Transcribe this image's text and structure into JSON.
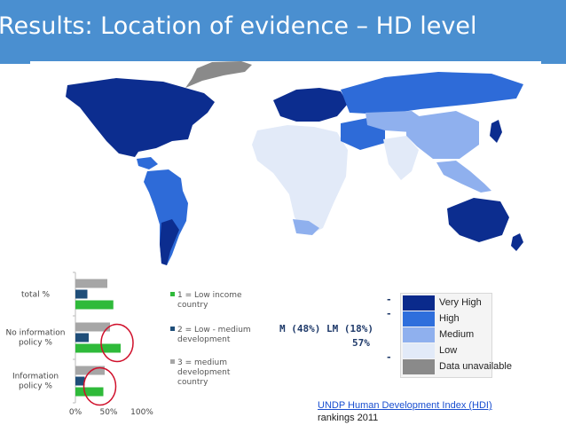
{
  "slide": {
    "title": "Results: Location of evidence – HD level"
  },
  "stats": {
    "line1": "-",
    "line2": "-",
    "line3": "M (48%) LM (18%)",
    "line4": "57%",
    "line5": "-"
  },
  "hdi_legend": {
    "items": [
      {
        "label": "Very High",
        "color": "#0a2a8c"
      },
      {
        "label": "High",
        "color": "#2f6fdc"
      },
      {
        "label": "Medium",
        "color": "#8fb0ee"
      },
      {
        "label": "Low",
        "color": "#e2eaf8"
      },
      {
        "label": "Data unavailable",
        "color": "#8a8a8a"
      }
    ]
  },
  "source": {
    "link_text": "UNDP Human Development Index (HDI)",
    "subtext": "rankings 2011"
  },
  "chart_data": {
    "type": "bar",
    "orientation": "horizontal",
    "categories": [
      "total %",
      "No information policy %",
      "Information policy %"
    ],
    "category_lines": [
      [
        "total %"
      ],
      [
        "No information",
        "policy %"
      ],
      [
        "Information",
        "policy %"
      ]
    ],
    "series": [
      {
        "name": "3 = medium development country",
        "name_lines": [
          "3 = medium",
          "development",
          "country"
        ],
        "color": "#a6a6a6",
        "values": [
          48,
          52,
          44
        ]
      },
      {
        "name": "2 = Low - medium development",
        "name_lines": [
          "2 = Low - medium",
          "development"
        ],
        "color": "#1f4e79",
        "values": [
          18,
          20,
          14
        ]
      },
      {
        "name": "1 = Low income country",
        "name_lines": [
          "1 = Low income",
          "country"
        ],
        "color": "#2fba3a",
        "values": [
          57,
          68,
          42
        ]
      }
    ],
    "xlim": [
      0,
      100
    ],
    "xticks": [
      "0%",
      "50%",
      "100%"
    ],
    "legend_position": "right",
    "highlight_color": "#d0102b"
  }
}
